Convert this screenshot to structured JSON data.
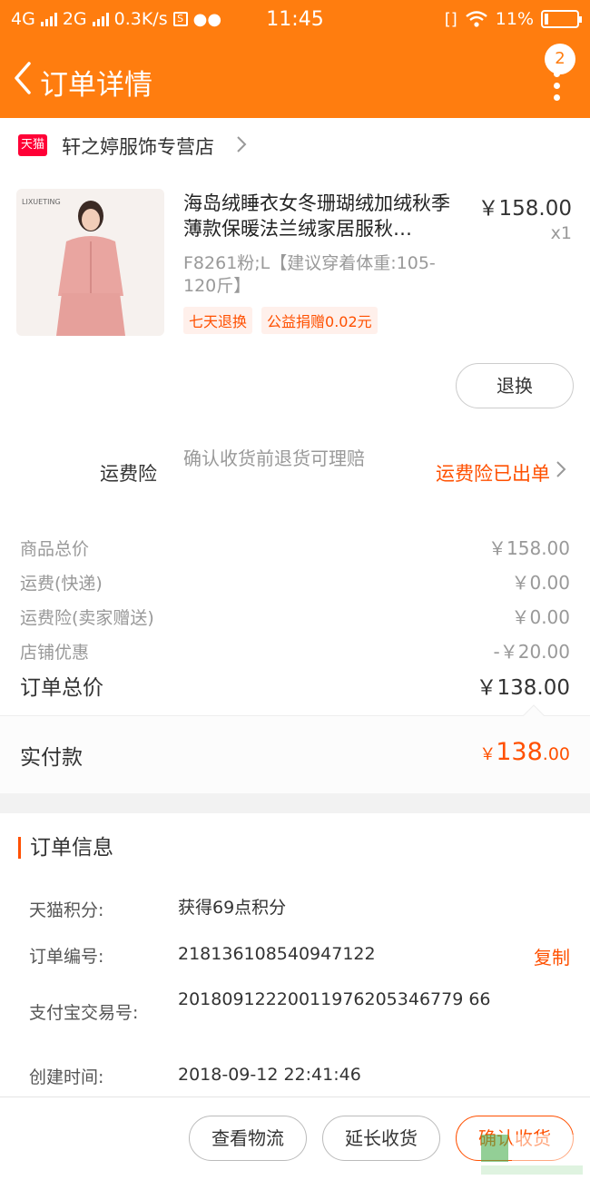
{
  "status_bar": {
    "network1": "4G",
    "network2": "2G",
    "speed": "0.3K/s",
    "time": "11:45",
    "battery": "11%"
  },
  "nav": {
    "title": "订单详情",
    "badge_count": "2"
  },
  "shop": {
    "logo_text": "天猫",
    "name": "轩之婷服饰专营店"
  },
  "product": {
    "thumb_brand": "LIXUETING",
    "title": "海岛绒睡衣女冬珊瑚绒加绒秋季薄款保暖法兰绒家居服秋…",
    "price": "￥158.00",
    "quantity": "x1",
    "sku": "F8261粉;L【建议穿着体重:105-120斤】",
    "tags": [
      "七天退换",
      "公益捐赠0.02元"
    ],
    "refund_button": "退换"
  },
  "insurance": {
    "label": "运费险",
    "description": "确认收货前退货可理赔",
    "status": "运费险已出单"
  },
  "costs": {
    "rows": [
      {
        "label": "商品总价",
        "value": "￥158.00"
      },
      {
        "label": "运费(快递)",
        "value": "￥0.00"
      },
      {
        "label": "运费险(卖家赠送)",
        "value": "￥0.00"
      },
      {
        "label": "店铺优惠",
        "value": "-￥20.00"
      }
    ],
    "total_label": "订单总价",
    "total_value": "￥138.00"
  },
  "paid": {
    "label": "实付款",
    "currency": "￥",
    "integer": "138",
    "decimal": ".00"
  },
  "order_info": {
    "heading": "订单信息",
    "rows": [
      {
        "key": "天猫积分:",
        "value": "获得69点积分"
      },
      {
        "key": "订单编号:",
        "value": "218136108540947122",
        "action": "复制"
      },
      {
        "key": "支付宝交易号:",
        "value": "20180912220011976205346779 66"
      },
      {
        "key": "创建时间:",
        "value": "2018-09-12 22:41:46"
      }
    ]
  },
  "actions": {
    "logistics": "查看物流",
    "extend": "延长收货",
    "confirm": "确认收货"
  },
  "colors": {
    "accent": "#ff7d0f",
    "highlight": "#ff5000",
    "tmall": "#ff0036"
  }
}
